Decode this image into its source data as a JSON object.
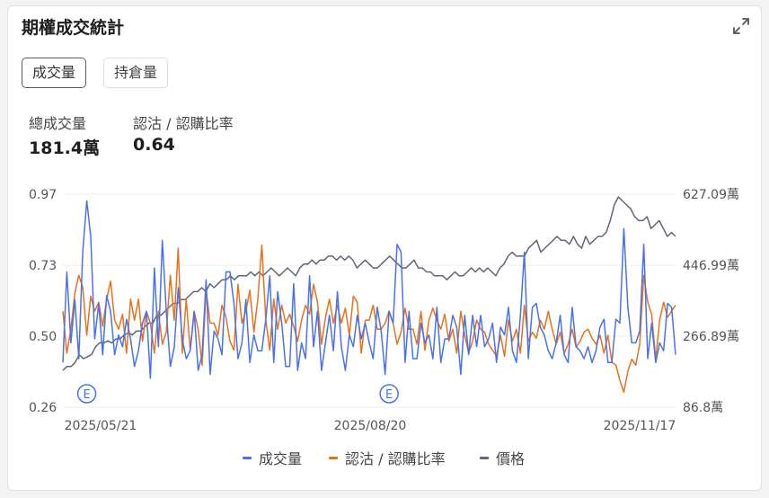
{
  "header": {
    "title": "期權成交統計",
    "expand_icon": "expand-icon"
  },
  "tabs": [
    {
      "label": "成交量",
      "active": true
    },
    {
      "label": "持倉量",
      "active": false
    }
  ],
  "stats": {
    "total_volume_label": "總成交量",
    "total_volume_value": "181.4萬",
    "ratio_label": "認沽 / 認購比率",
    "ratio_value": "0.64"
  },
  "colors": {
    "volume": "#4a72e8",
    "ratio": "#e8721c",
    "price": "#5f6678"
  },
  "chart_data": {
    "type": "line",
    "x_tick_labels": [
      "2025/05/21",
      "2025/08/20",
      "2025/11/17"
    ],
    "y_left_ticks": [
      "0.97",
      "0.73",
      "0.50",
      "0.26"
    ],
    "y_left_range": [
      0.26,
      0.97
    ],
    "y_right_ticks": [
      "627.09萬",
      "446.99萬",
      "266.89萬",
      "86.8萬"
    ],
    "y_right_range": [
      86.8,
      627.09
    ],
    "event_markers": [
      {
        "label": "E",
        "index": 6
      },
      {
        "label": "E",
        "index": 82
      }
    ],
    "series": [
      {
        "name": "成交量",
        "axis": "right",
        "color": "#4a72e8",
        "values": [
          200,
          430,
          250,
          360,
          210,
          480,
          610,
          520,
          260,
          350,
          220,
          370,
          330,
          220,
          270,
          240,
          310,
          260,
          190,
          230,
          300,
          330,
          160,
          440,
          240,
          510,
          330,
          190,
          240,
          390,
          260,
          210,
          230,
          330,
          180,
          220,
          410,
          170,
          280,
          260,
          220,
          430,
          430,
          350,
          210,
          250,
          360,
          200,
          270,
          230,
          230,
          310,
          420,
          200,
          380,
          300,
          190,
          190,
          400,
          180,
          250,
          210,
          420,
          240,
          330,
          180,
          250,
          320,
          230,
          380,
          240,
          180,
          270,
          240,
          320,
          260,
          300,
          250,
          210,
          340,
          280,
          170,
          330,
          300,
          500,
          480,
          200,
          330,
          210,
          210,
          300,
          250,
          270,
          210,
          340,
          200,
          260,
          260,
          320,
          290,
          170,
          320,
          220,
          320,
          240,
          320,
          240,
          260,
          300,
          200,
          290,
          270,
          340,
          230,
          200,
          320,
          480,
          210,
          340,
          350,
          290,
          270,
          230,
          210,
          250,
          320,
          220,
          200,
          340,
          240,
          230,
          210,
          240,
          200,
          230,
          290,
          310,
          200,
          200,
          310,
          300,
          540,
          340,
          250,
          250,
          280,
          500,
          210,
          300,
          200,
          250,
          230,
          350,
          340,
          220
        ]
      },
      {
        "name": "認沽 / 認購比率",
        "axis": "left",
        "color": "#e8721c",
        "values": [
          0.58,
          0.44,
          0.52,
          0.64,
          0.7,
          0.66,
          0.5,
          0.63,
          0.58,
          0.61,
          0.53,
          0.62,
          0.68,
          0.55,
          0.52,
          0.57,
          0.44,
          0.62,
          0.55,
          0.62,
          0.48,
          0.58,
          0.54,
          0.44,
          0.58,
          0.47,
          0.51,
          0.7,
          0.55,
          0.79,
          0.44,
          0.62,
          0.45,
          0.58,
          0.52,
          0.4,
          0.65,
          0.54,
          0.54,
          0.5,
          0.6,
          0.56,
          0.48,
          0.45,
          0.67,
          0.54,
          0.58,
          0.65,
          0.51,
          0.62,
          0.8,
          0.55,
          0.45,
          0.62,
          0.52,
          0.6,
          0.54,
          0.57,
          0.53,
          0.48,
          0.55,
          0.6,
          0.57,
          0.67,
          0.61,
          0.47,
          0.56,
          0.62,
          0.54,
          0.6,
          0.54,
          0.59,
          0.5,
          0.63,
          0.61,
          0.44,
          0.55,
          0.55,
          0.6,
          0.52,
          0.52,
          0.54,
          0.58,
          0.54,
          0.47,
          0.51,
          0.59,
          0.52,
          0.52,
          0.47,
          0.58,
          0.45,
          0.55,
          0.59,
          0.55,
          0.52,
          0.57,
          0.48,
          0.52,
          0.44,
          0.58,
          0.5,
          0.44,
          0.48,
          0.55,
          0.52,
          0.51,
          0.47,
          0.45,
          0.43,
          0.5,
          0.43,
          0.55,
          0.48,
          0.52,
          0.44,
          0.6,
          0.48,
          0.51,
          0.49,
          0.55,
          0.52,
          0.58,
          0.52,
          0.47,
          0.51,
          0.44,
          0.47,
          0.52,
          0.46,
          0.48,
          0.51,
          0.52,
          0.49,
          0.47,
          0.5,
          0.44,
          0.5,
          0.41,
          0.4,
          0.35,
          0.31,
          0.38,
          0.42,
          0.4,
          0.47,
          0.7,
          0.61,
          0.57,
          0.42,
          0.55,
          0.61,
          0.56,
          0.58,
          0.6
        ]
      },
      {
        "name": "價格",
        "axis": "right",
        "color": "#5f6678",
        "values": [
          180,
          190,
          190,
          200,
          220,
          210,
          215,
          220,
          240,
          250,
          250,
          255,
          250,
          260,
          260,
          270,
          275,
          270,
          280,
          280,
          290,
          300,
          300,
          320,
          320,
          330,
          340,
          350,
          350,
          360,
          360,
          370,
          380,
          380,
          390,
          380,
          400,
          390,
          400,
          410,
          410,
          420,
          410,
          420,
          420,
          420,
          430,
          420,
          430,
          420,
          430,
          440,
          430,
          420,
          430,
          440,
          430,
          420,
          440,
          450,
          450,
          460,
          450,
          460,
          460,
          470,
          470,
          460,
          470,
          460,
          470,
          460,
          440,
          450,
          460,
          450,
          440,
          440,
          450,
          460,
          470,
          460,
          450,
          440,
          440,
          450,
          460,
          440,
          440,
          430,
          430,
          420,
          420,
          420,
          410,
          420,
          430,
          420,
          420,
          430,
          440,
          430,
          440,
          430,
          440,
          430,
          420,
          440,
          450,
          470,
          480,
          470,
          470,
          470,
          490,
          500,
          510,
          480,
          490,
          500,
          510,
          520,
          510,
          510,
          500,
          520,
          500,
          490,
          520,
          500,
          510,
          520,
          520,
          530,
          560,
          600,
          620,
          610,
          600,
          590,
          570,
          560,
          560,
          570,
          540,
          550,
          560,
          540,
          520,
          530,
          520
        ]
      }
    ],
    "legend_position": "bottom-center",
    "grid": true
  }
}
